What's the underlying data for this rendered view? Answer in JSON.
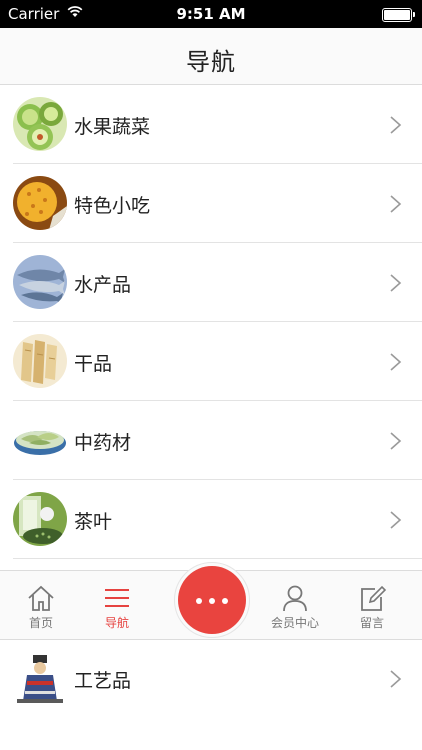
{
  "status_bar": {
    "carrier": "Carrier",
    "time": "9:51 AM"
  },
  "nav": {
    "title": "导航"
  },
  "categories": [
    {
      "label": "水果蔬菜",
      "icon": "fruit-vegetable-thumbnail"
    },
    {
      "label": "特色小吃",
      "icon": "snack-thumbnail"
    },
    {
      "label": "水产品",
      "icon": "seafood-thumbnail"
    },
    {
      "label": "干品",
      "icon": "dried-goods-thumbnail"
    },
    {
      "label": "中药材",
      "icon": "herbal-medicine-thumbnail"
    },
    {
      "label": "茶叶",
      "icon": "tea-thumbnail"
    },
    {
      "label": "工艺品",
      "icon": "handicraft-thumbnail"
    }
  ],
  "tabbar": {
    "home": "首页",
    "nav": "导航",
    "member": "会员中心",
    "message": "留言",
    "accent": "#e64340"
  }
}
